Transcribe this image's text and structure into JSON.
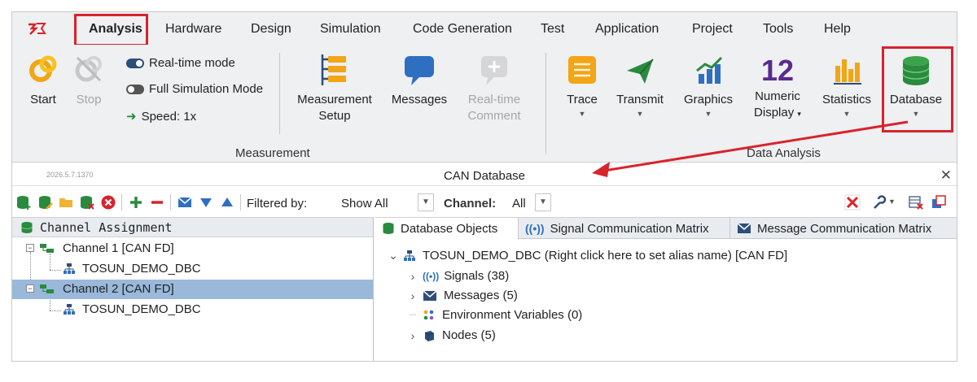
{
  "menu": {
    "tabs": [
      "Analysis",
      "Hardware",
      "Design",
      "Simulation",
      "Code Generation",
      "Test",
      "Application",
      "Project",
      "Tools",
      "Help"
    ]
  },
  "ribbon": {
    "start_label": "Start",
    "stop_label": "Stop",
    "realtime_mode": "Real-time mode",
    "full_sim_mode": "Full Simulation Mode",
    "speed": "Speed: 1x",
    "measurement_setup": [
      "Measurement",
      "Setup"
    ],
    "messages": "Messages",
    "realtime_comment": [
      "Real-time",
      "Comment"
    ],
    "measurement_group": "Measurement",
    "trace": "Trace",
    "transmit": "Transmit",
    "graphics": "Graphics",
    "numeric_display": [
      "Numeric",
      "Display"
    ],
    "numeric_icon_text": "12",
    "statistics": "Statistics",
    "database": "Database",
    "data_analysis_group": "Data Analysis"
  },
  "window": {
    "version": "2026.5.7.1370",
    "title": "CAN Database",
    "close": "✕"
  },
  "toolbar": {
    "filtered_by_label": "Filtered by:",
    "filtered_by_value": "Show All",
    "channel_label": "Channel:",
    "channel_value": "All"
  },
  "left_panel": {
    "header": "Channel Assignment",
    "channel1": "Channel 1 [CAN FD]",
    "channel1_db": "TOSUN_DEMO_DBC",
    "channel2": "Channel 2 [CAN FD]",
    "channel2_db": "TOSUN_DEMO_DBC"
  },
  "right_panel": {
    "tabs": [
      "Database Objects",
      "Signal Communication Matrix",
      "Message Communication Matrix"
    ],
    "root": "TOSUN_DEMO_DBC (Right click here to set alias name) [CAN FD]",
    "signals": "Signals (38)",
    "messages": "Messages (5)",
    "env_vars": "Environment Variables (0)",
    "nodes": "Nodes (5)"
  },
  "colors": {
    "highlight_red": "#d9232b",
    "selection_blue": "#9ab9da",
    "ribbon_bg": "#eef0f2"
  }
}
